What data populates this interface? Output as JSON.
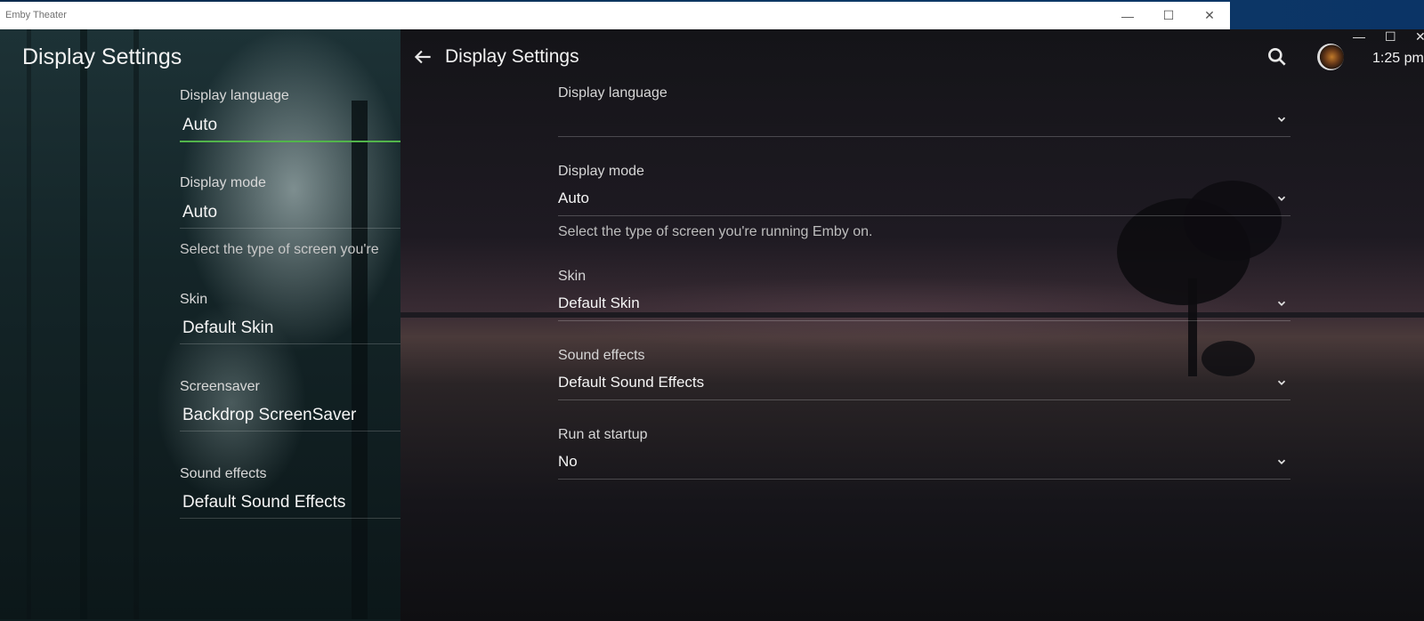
{
  "window": {
    "title": "Emby Theater",
    "minimize": "—",
    "maximize": "☐",
    "close": "✕"
  },
  "left_panel": {
    "title": "Display Settings",
    "fields": [
      {
        "label": "Display language",
        "value": "Auto"
      },
      {
        "label": "Display mode",
        "value": "Auto",
        "description": "Select the type of screen you're"
      },
      {
        "label": "Skin",
        "value": "Default Skin"
      },
      {
        "label": "Screensaver",
        "value": "Backdrop ScreenSaver"
      },
      {
        "label": "Sound effects",
        "value": "Default Sound Effects"
      }
    ]
  },
  "right_panel": {
    "title": "Display Settings",
    "clock": "1:25 pm",
    "fields": [
      {
        "label": "Display language",
        "value": ""
      },
      {
        "label": "Display mode",
        "value": "Auto",
        "description": "Select the type of screen you're running Emby on."
      },
      {
        "label": "Skin",
        "value": "Default Skin"
      },
      {
        "label": "Sound effects",
        "value": "Default Sound Effects"
      },
      {
        "label": "Run at startup",
        "value": "No"
      }
    ]
  },
  "icons": {
    "back": "arrow-left-icon",
    "search": "search-icon",
    "chevron": "chevron-down-icon",
    "avatar": "user-avatar"
  },
  "colors": {
    "accent": "#52b54b"
  }
}
